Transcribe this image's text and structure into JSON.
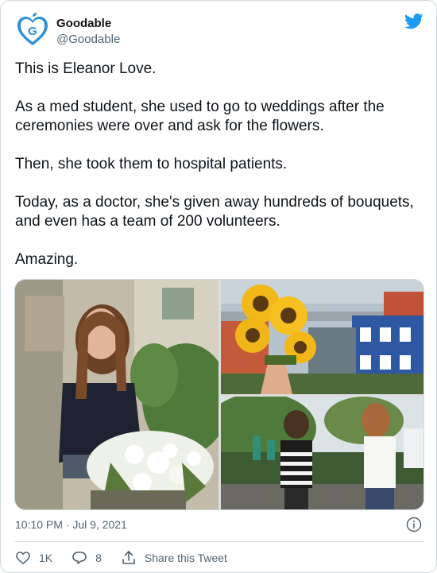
{
  "tweet": {
    "author_name": "Goodable",
    "author_handle": "@Goodable",
    "avatar_icon": "goodable-heart-logo",
    "platform_icon": "twitter-bird-icon",
    "paragraphs": [
      "This is Eleanor Love.",
      "As a med student, she used to go to weddings after the ceremonies were over and ask for the flowers.",
      "Then, she took them to hospital patients.",
      "Today, as a doctor, she's given away hundreds of bouquets, and even has a team of 200 volunteers.",
      "Amazing."
    ],
    "timestamp": "10:10 PM · Jul 9, 2021",
    "likes": "1K",
    "replies": "8",
    "share_label": "Share this Tweet"
  },
  "colors": {
    "accent": "#1d9bf0",
    "text": "#0f1419",
    "muted": "#536471",
    "border": "#cfd9de"
  }
}
